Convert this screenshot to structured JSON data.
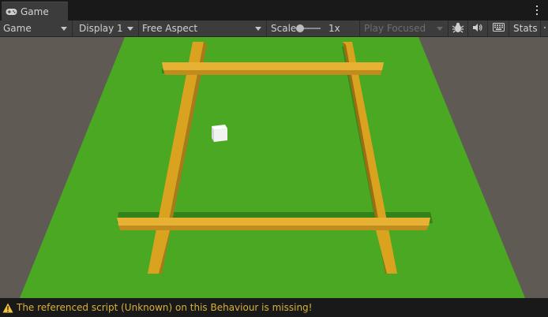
{
  "tab": {
    "title": "Game",
    "icon": "gamepad-icon"
  },
  "toolbar": {
    "view_mode": "Game",
    "display": "Display 1",
    "aspect": "Free Aspect",
    "scale_label": "Scale",
    "scale_value": "1x",
    "play_mode": "Play Focused",
    "stats_label": "Stats",
    "icons": [
      "bug-icon",
      "speaker-icon",
      "keyboard-icon",
      "more-icon"
    ]
  },
  "status": {
    "message": "The referenced script (Unknown) on this Behaviour is missing!",
    "warning_color": "#d8b13a"
  },
  "scene": {
    "ground_color": "#4aa823",
    "fence_color": "#d9a320",
    "background_color": "#5f5a54",
    "cube_color": "#f2f2f2"
  }
}
